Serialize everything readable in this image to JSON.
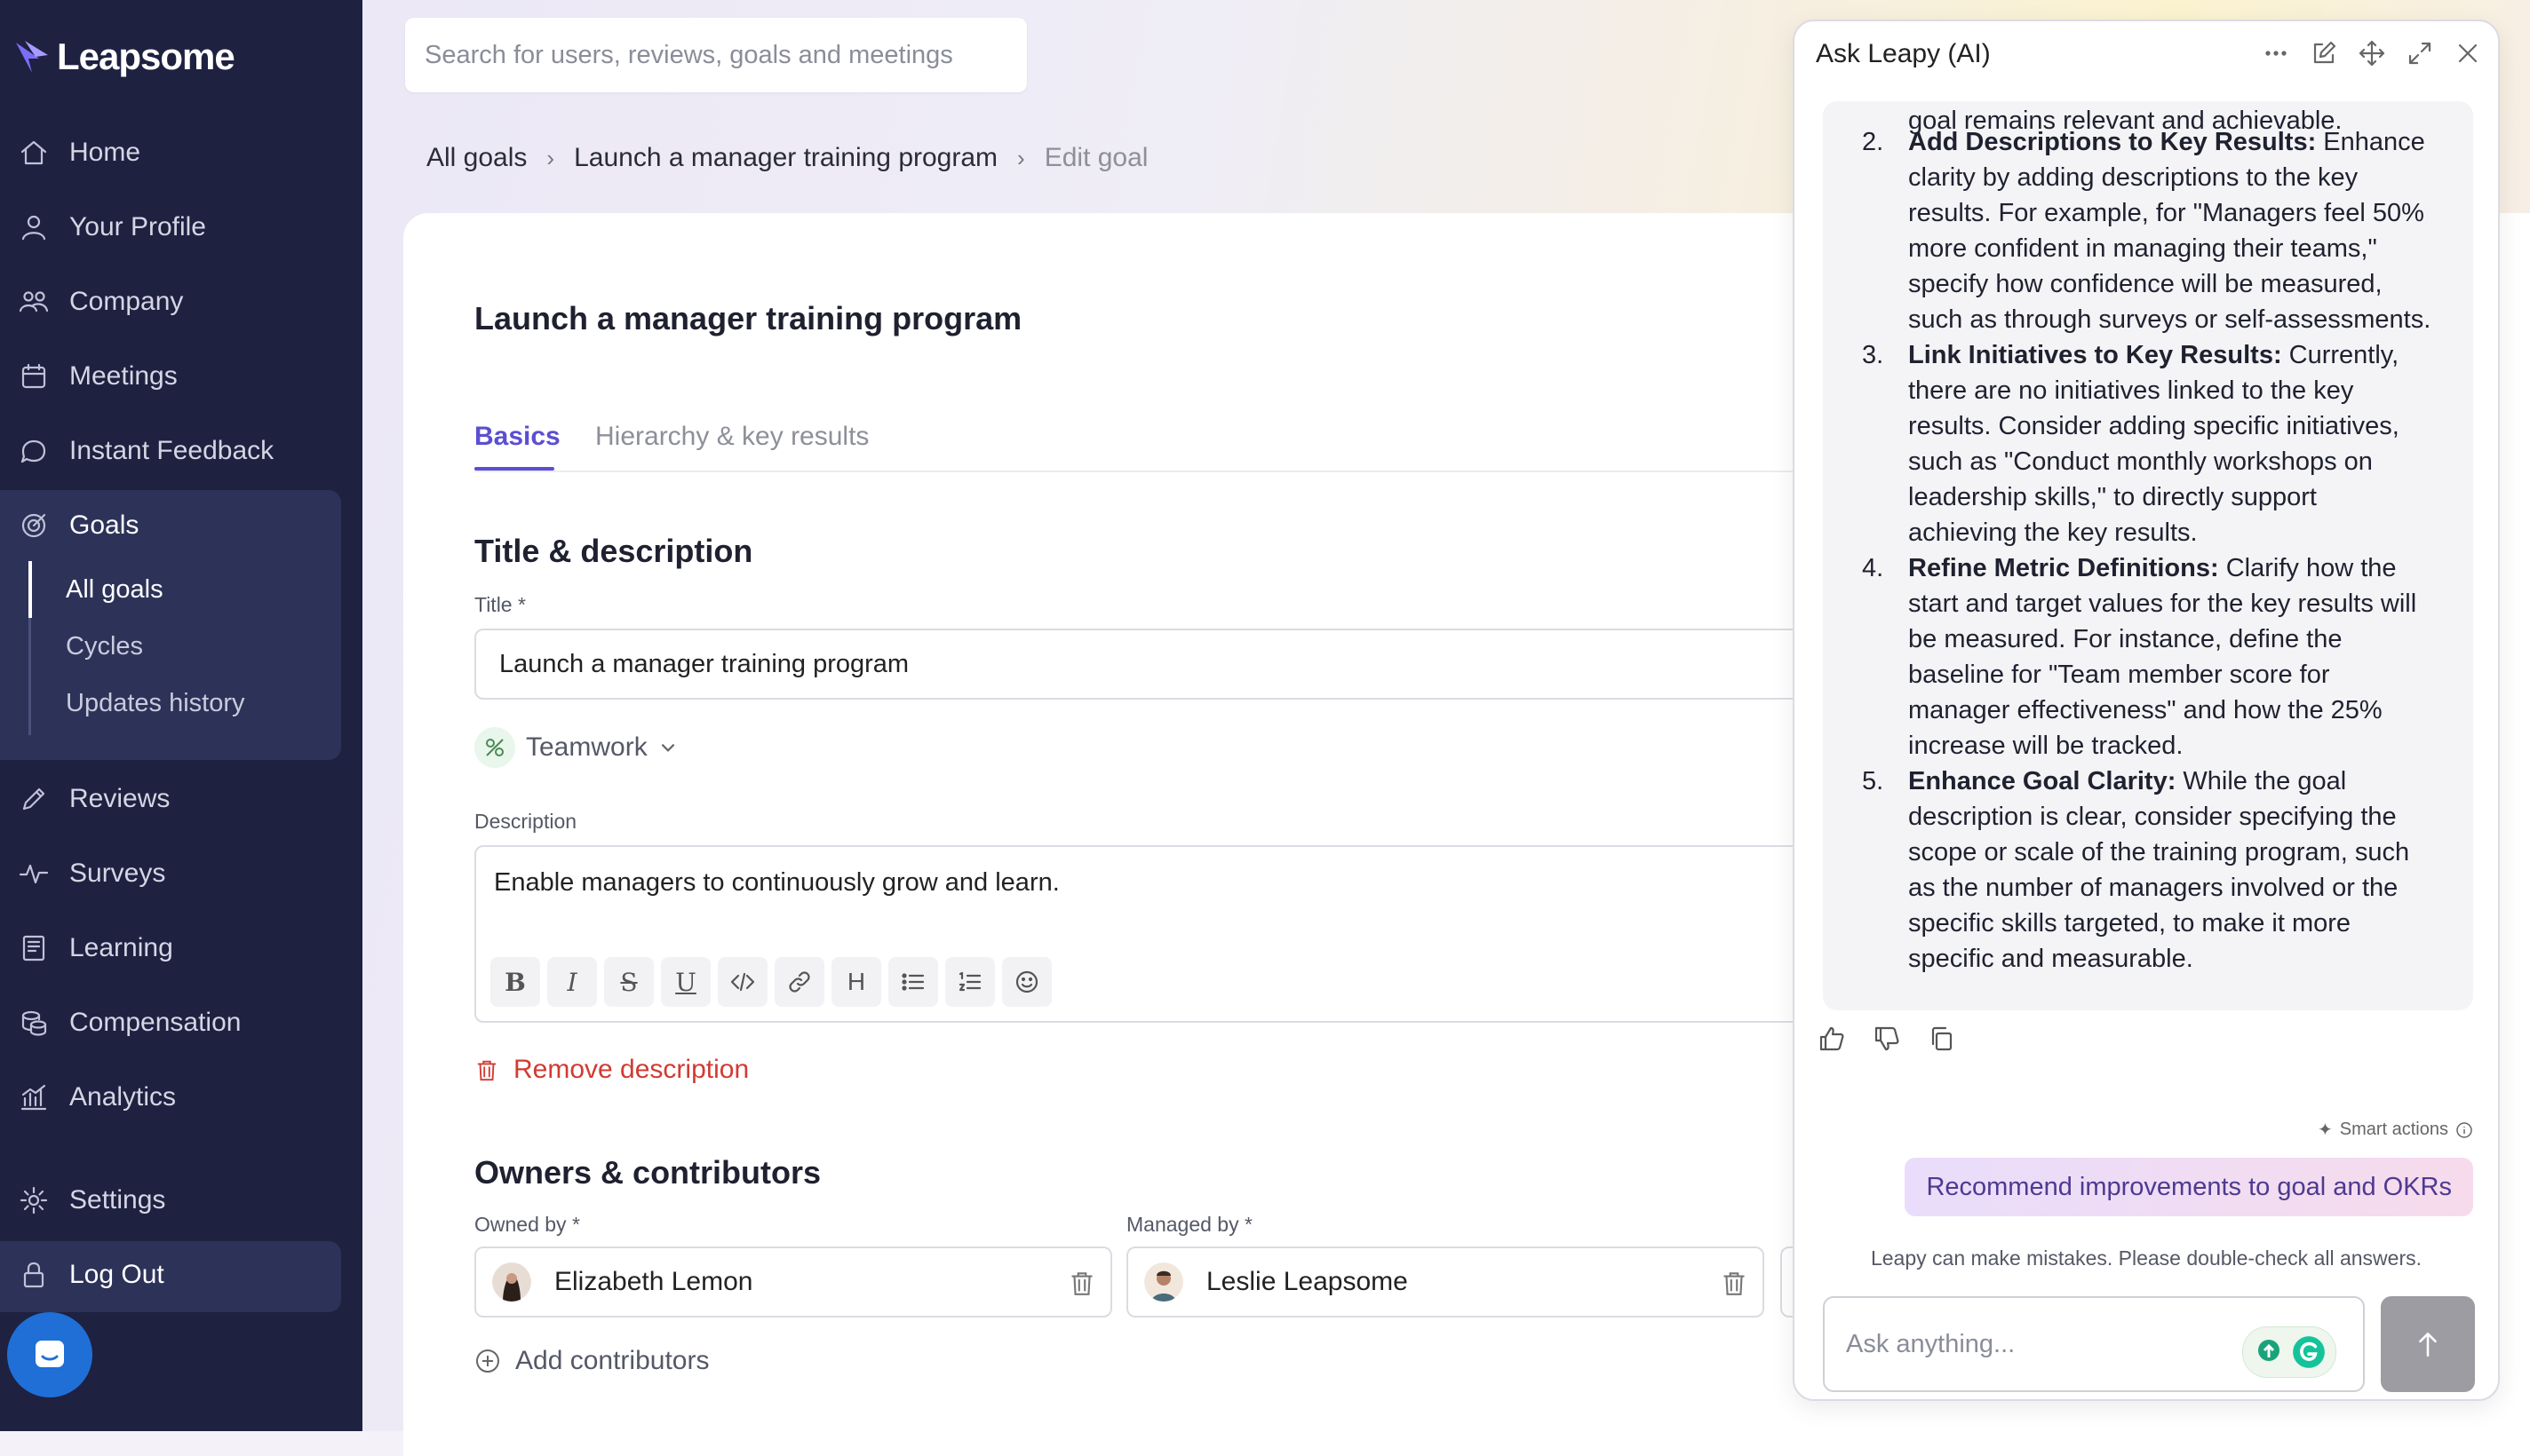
{
  "brand": {
    "name": "Leapsome",
    "accent": "#5b4fd1",
    "sidebar_bg": "#1e2140"
  },
  "sidebar": {
    "items": [
      {
        "label": "Home",
        "icon": "home-icon"
      },
      {
        "label": "Your Profile",
        "icon": "user-icon"
      },
      {
        "label": "Company",
        "icon": "people-icon"
      },
      {
        "label": "Meetings",
        "icon": "calendar-icon"
      },
      {
        "label": "Instant Feedback",
        "icon": "chat-icon"
      },
      {
        "label": "Goals",
        "icon": "target-icon"
      },
      {
        "label": "Reviews",
        "icon": "pencil-icon"
      },
      {
        "label": "Surveys",
        "icon": "pulse-icon"
      },
      {
        "label": "Learning",
        "icon": "book-icon"
      },
      {
        "label": "Compensation",
        "icon": "coins-icon"
      },
      {
        "label": "Analytics",
        "icon": "chart-icon"
      },
      {
        "label": "Settings",
        "icon": "gear-icon"
      },
      {
        "label": "Log Out",
        "icon": "lock-icon"
      }
    ],
    "goals_sub": [
      "All goals",
      "Cycles",
      "Updates history"
    ]
  },
  "search": {
    "placeholder": "Search for users, reviews, goals and meetings"
  },
  "breadcrumb": {
    "items": [
      "All goals",
      "Launch a manager training program",
      "Edit goal"
    ]
  },
  "page": {
    "title": "Launch a manager training program",
    "tabs": [
      "Basics",
      "Hierarchy & key results"
    ],
    "section_title_desc": "Title & description",
    "title_label": "Title *",
    "title_value": "Launch a manager training program",
    "tag": "Teamwork",
    "desc_label": "Description",
    "desc_value": "Enable managers to continuously grow and learn.",
    "remove_desc": "Remove description",
    "section_owners": "Owners & contributors",
    "owned_by_label": "Owned by *",
    "owned_by": "Elizabeth Lemon",
    "managed_by_label": "Managed by *",
    "managed_by": "Leslie Leapsome",
    "add_contributors": "Add contributors"
  },
  "ai": {
    "title": "Ask Leapy (AI)",
    "lines": [
      {
        "num": "",
        "text": "goal remains relevant and achievable."
      },
      {
        "num": "2.",
        "bold": "Add Descriptions to Key Results:",
        "text": " Enhance"
      },
      {
        "num": "",
        "text": "clarity by adding descriptions to the key"
      },
      {
        "num": "",
        "text": "results. For example, for \"Managers feel 50%"
      },
      {
        "num": "",
        "text": "more confident in managing their teams,\""
      },
      {
        "num": "",
        "text": "specify how confidence will be measured,"
      },
      {
        "num": "",
        "text": "such as through surveys or self-assessments."
      },
      {
        "num": "3.",
        "bold": "Link Initiatives to Key Results:",
        "text": " Currently,"
      },
      {
        "num": "",
        "text": "there are no initiatives linked to the key"
      },
      {
        "num": "",
        "text": "results. Consider adding specific initiatives,"
      },
      {
        "num": "",
        "text": "such as \"Conduct monthly workshops on"
      },
      {
        "num": "",
        "text": "leadership skills,\" to directly support"
      },
      {
        "num": "",
        "text": "achieving the key results."
      },
      {
        "num": "4.",
        "bold": "Refine Metric Definitions:",
        "text": " Clarify how the"
      },
      {
        "num": "",
        "text": "start and target values for the key results will"
      },
      {
        "num": "",
        "text": "be measured. For instance, define the"
      },
      {
        "num": "",
        "text": "baseline for \"Team member score for"
      },
      {
        "num": "",
        "text": "manager effectiveness\" and how the 25%"
      },
      {
        "num": "",
        "text": "increase will be tracked."
      },
      {
        "num": "5.",
        "bold": "Enhance Goal Clarity:",
        "text": " While the goal"
      },
      {
        "num": "",
        "text": "description is clear, consider specifying the"
      },
      {
        "num": "",
        "text": "scope or scale of the training program, such"
      },
      {
        "num": "",
        "text": "as the number of managers involved or the"
      },
      {
        "num": "",
        "text": "specific skills targeted, to make it more"
      },
      {
        "num": "",
        "text": "specific and measurable."
      }
    ],
    "smart_actions": "Smart actions",
    "suggestion": "Recommend improvements to goal and OKRs",
    "disclaimer": "Leapy can make mistakes. Please double-check all answers.",
    "input_placeholder": "Ask anything..."
  }
}
